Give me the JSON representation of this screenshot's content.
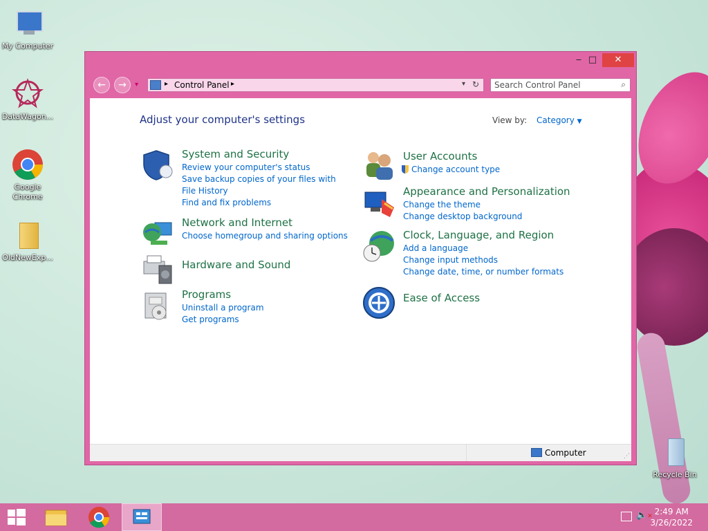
{
  "desktop": {
    "icons": [
      {
        "label": "My Computer"
      },
      {
        "label": "DataWagon..."
      },
      {
        "label": "Google Chrome"
      },
      {
        "label": "OldNewExp..."
      },
      {
        "label": "Recycle Bin"
      }
    ]
  },
  "window": {
    "controls": {
      "minimize": "‒",
      "maximize": "□",
      "close": "✕"
    },
    "address": {
      "path": "Control Panel"
    },
    "search": {
      "placeholder": "Search Control Panel"
    },
    "heading": "Adjust your computer's settings",
    "view_by": {
      "label": "View by:",
      "value": "Category"
    },
    "categories_left": [
      {
        "title": "System and Security",
        "links": [
          "Review your computer's status",
          "Save backup copies of your files with File History",
          "Find and fix problems"
        ]
      },
      {
        "title": "Network and Internet",
        "links": [
          "Choose homegroup and sharing options"
        ]
      },
      {
        "title": "Hardware and Sound",
        "links": []
      },
      {
        "title": "Programs",
        "links": [
          "Uninstall a program",
          "Get programs"
        ]
      }
    ],
    "categories_right": [
      {
        "title": "User Accounts",
        "links": [
          "Change account type"
        ]
      },
      {
        "title": "Appearance and Personalization",
        "links": [
          "Change the theme",
          "Change desktop background"
        ]
      },
      {
        "title": "Clock, Language, and Region",
        "links": [
          "Add a language",
          "Change input methods",
          "Change date, time, or number formats"
        ]
      },
      {
        "title": "Ease of Access",
        "links": []
      }
    ],
    "status": {
      "location": "Computer"
    }
  },
  "taskbar": {
    "time": "2:49 AM",
    "date": "3/26/2022"
  },
  "colors": {
    "accent": "#e066a6",
    "link": "#0066cc",
    "category_title": "#1e7145",
    "heading": "#1e3287"
  }
}
